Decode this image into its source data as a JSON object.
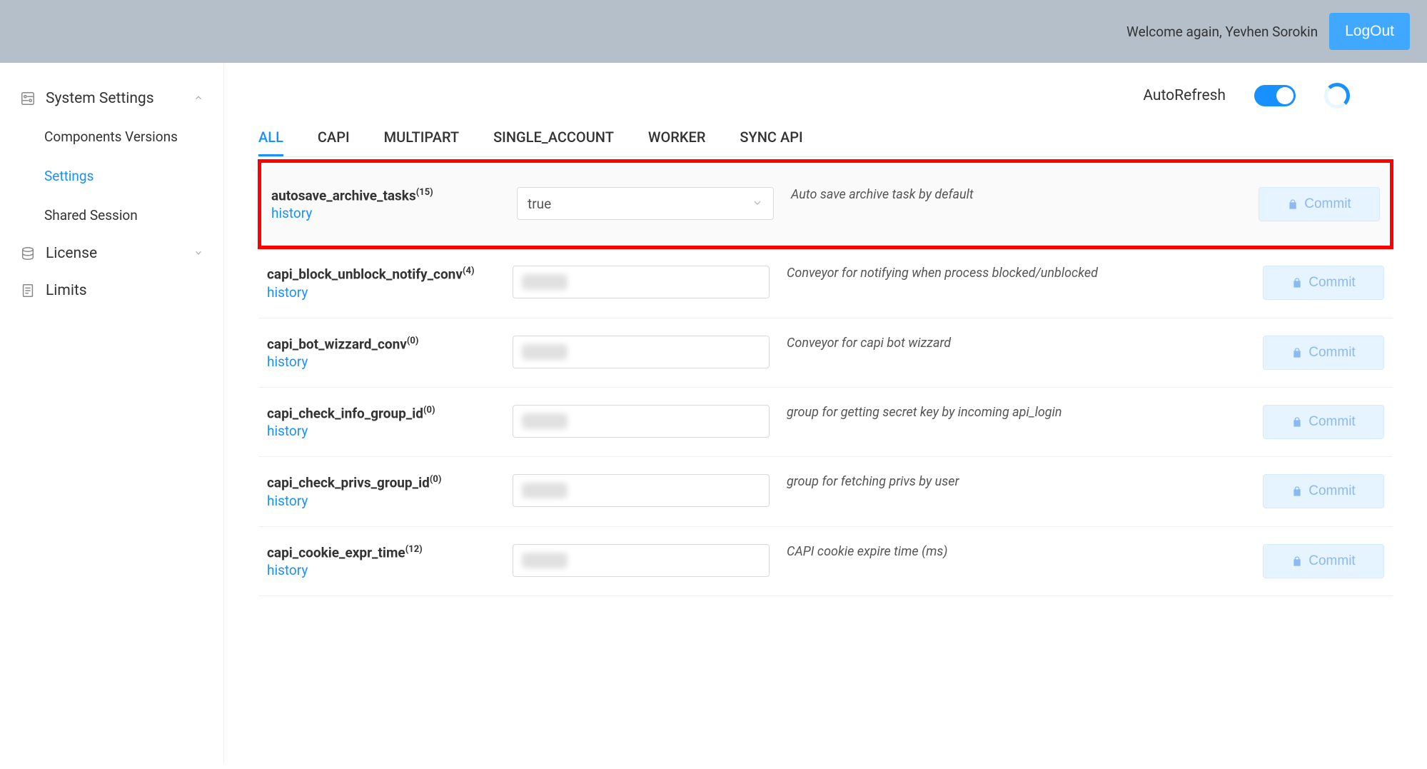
{
  "header": {
    "welcome_text": "Welcome again, Yevhen Sorokin",
    "logout_label": "LogOut"
  },
  "sidebar": {
    "section_settings": {
      "label": "System Settings"
    },
    "items": [
      {
        "label": "Components Versions"
      },
      {
        "label": "Settings"
      },
      {
        "label": "Shared Session"
      }
    ],
    "section_license": {
      "label": "License"
    },
    "section_limits": {
      "label": "Limits"
    }
  },
  "autorefresh": {
    "label": "AutoRefresh",
    "on": true
  },
  "tabs": [
    {
      "label": "ALL",
      "active": true
    },
    {
      "label": "CAPI"
    },
    {
      "label": "MULTIPART"
    },
    {
      "label": "SINGLE_ACCOUNT"
    },
    {
      "label": "WORKER"
    },
    {
      "label": "SYNC API"
    }
  ],
  "history_label": "history",
  "commit_label": "Commit",
  "settings": [
    {
      "name": "autosave_archive_tasks",
      "sup": "(15)",
      "value": "true",
      "value_type": "select",
      "desc": "Auto save archive task by default",
      "highlighted": true
    },
    {
      "name": "capi_block_unblock_notify_conv",
      "sup": "(4)",
      "value": "",
      "value_type": "text",
      "desc": "Conveyor for notifying when process blocked/unblocked"
    },
    {
      "name": "capi_bot_wizzard_conv",
      "sup": "(0)",
      "value": "",
      "value_type": "text",
      "desc": "Conveyor for capi bot wizzard"
    },
    {
      "name": "capi_check_info_group_id",
      "sup": "(0)",
      "value": "",
      "value_type": "text",
      "desc": "group for getting secret key by incoming api_login"
    },
    {
      "name": "capi_check_privs_group_id",
      "sup": "(0)",
      "value": "",
      "value_type": "text",
      "desc": "group for fetching privs by user"
    },
    {
      "name": "capi_cookie_expr_time",
      "sup": "(12)",
      "value": "",
      "value_type": "text",
      "desc": "CAPI cookie expire time (ms)"
    }
  ]
}
